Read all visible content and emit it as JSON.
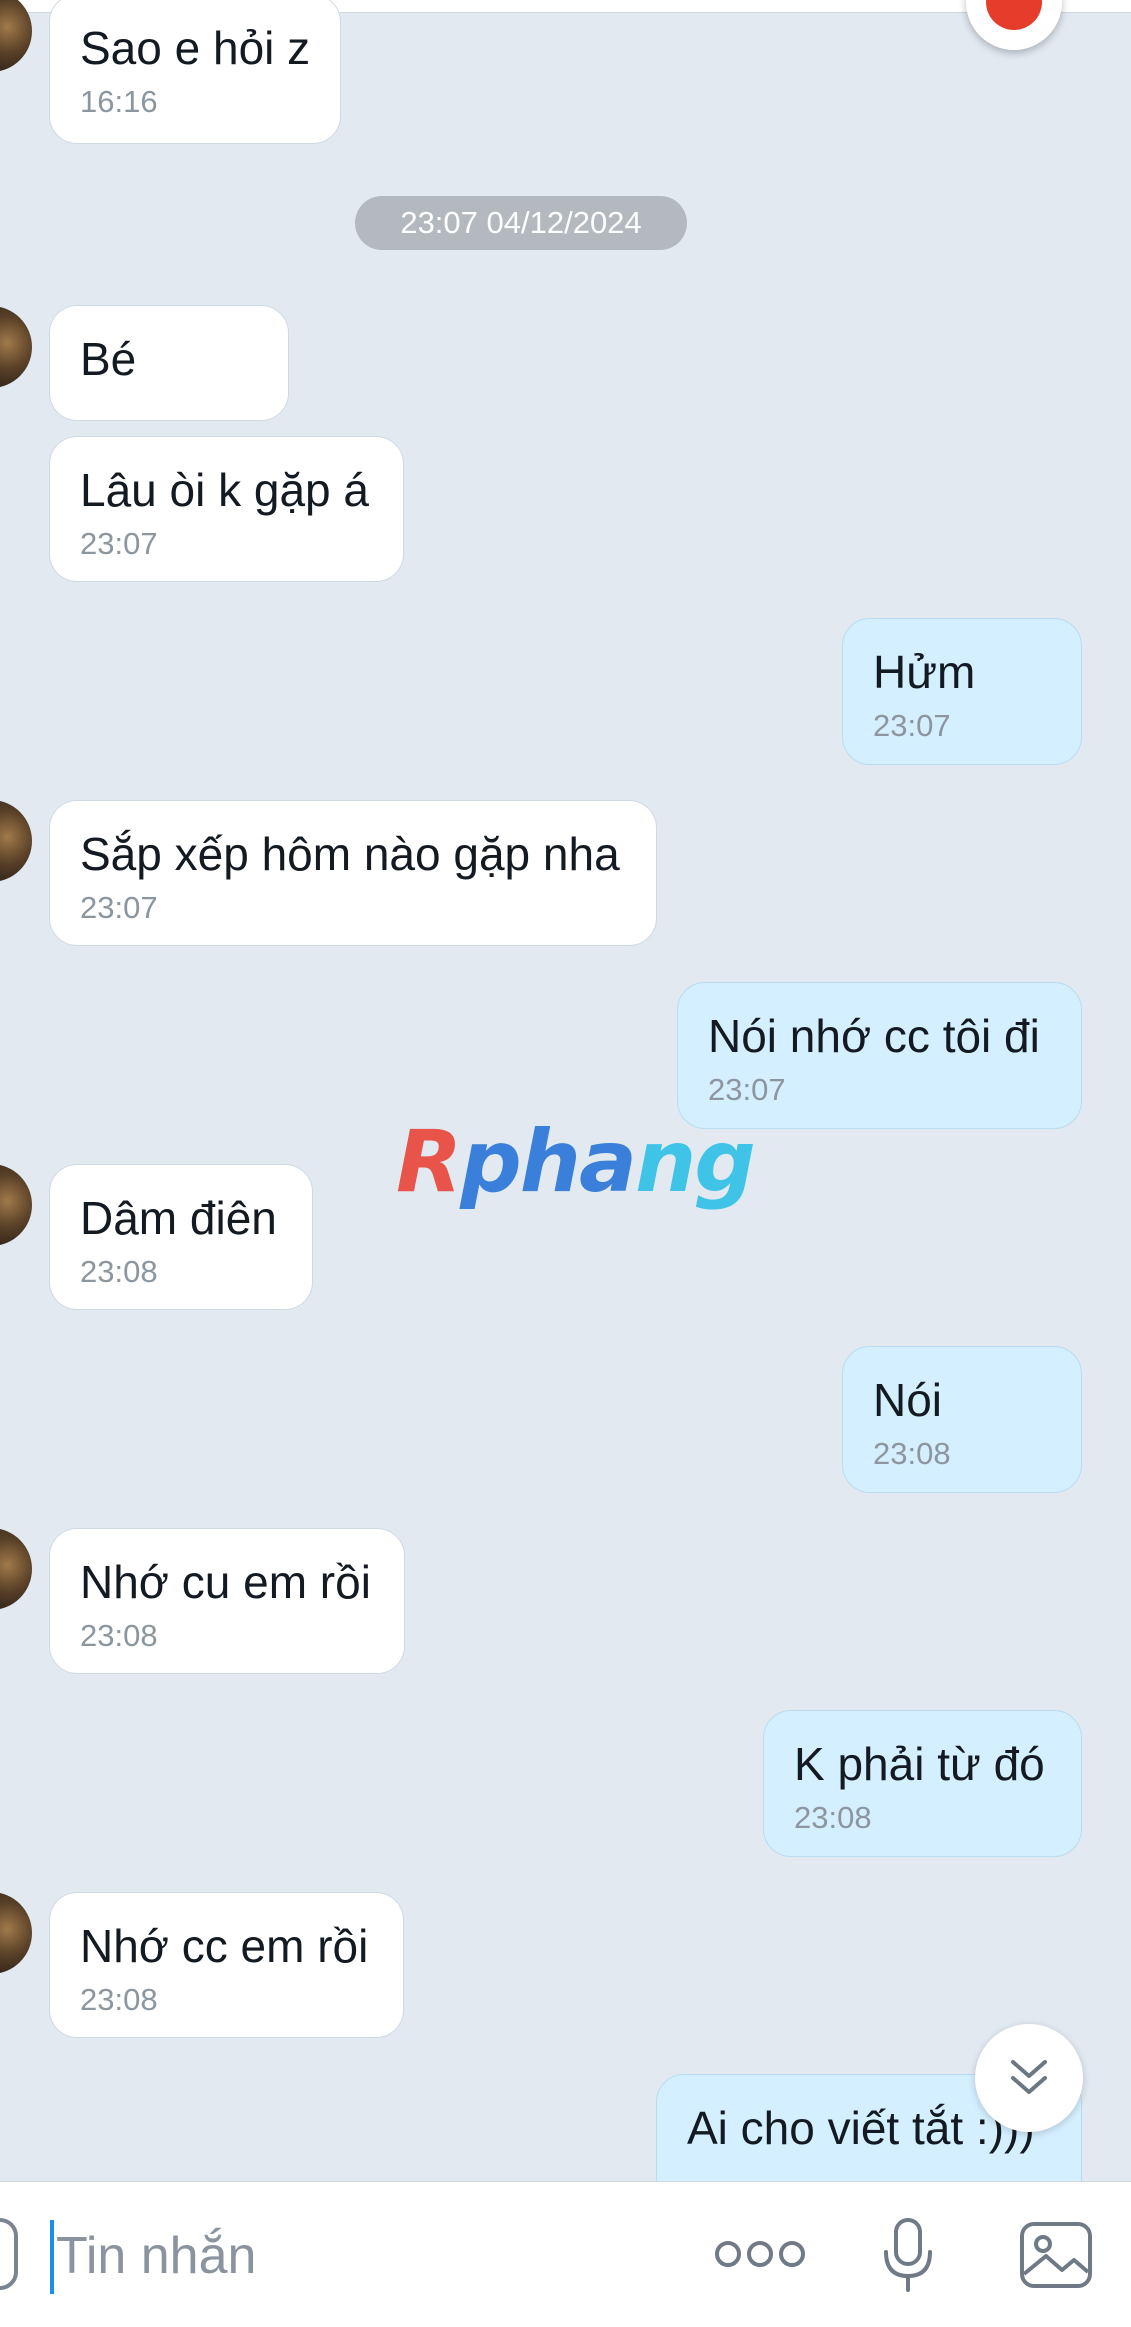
{
  "date_separator": "23:07 04/12/2024",
  "watermark": {
    "part1": "R",
    "part2": "pha",
    "part3": "ng"
  },
  "messages": [
    {
      "side": "in",
      "text": "Sao e hỏi z",
      "time": "16:16"
    },
    {
      "side": "in",
      "text": "Bé",
      "time": ""
    },
    {
      "side": "in",
      "text": "Lâu òi k gặp á",
      "time": "23:07"
    },
    {
      "side": "out",
      "text": "Hửm",
      "time": "23:07"
    },
    {
      "side": "in",
      "text": "Sắp xếp hôm nào gặp nha",
      "time": "23:07"
    },
    {
      "side": "out",
      "text": "Nói nhớ cc tôi đi",
      "time": "23:07"
    },
    {
      "side": "in",
      "text": "Dâm điên",
      "time": "23:08"
    },
    {
      "side": "out",
      "text": "Nói",
      "time": "23:08"
    },
    {
      "side": "in",
      "text": "Nhớ cu em rồi",
      "time": "23:08"
    },
    {
      "side": "out",
      "text": "K phải từ đó",
      "time": "23:08"
    },
    {
      "side": "in",
      "text": "Nhớ cc em rồi",
      "time": "23:08"
    },
    {
      "side": "out",
      "text": "Ai cho viết tắt :)))",
      "time": ""
    }
  ],
  "composer": {
    "placeholder": "Tin nhắn"
  },
  "icons": {
    "reaction": "angry-emoji-icon",
    "scroll_down": "chevron-double-down-icon",
    "sticker": "sticker-icon",
    "more": "more-options-icon",
    "mic": "microphone-icon",
    "image": "image-icon"
  },
  "colors": {
    "background": "#e2e9f1",
    "incoming_bubble": "#ffffff",
    "outgoing_bubble": "#d4efff",
    "caret": "#1e8fe8"
  }
}
